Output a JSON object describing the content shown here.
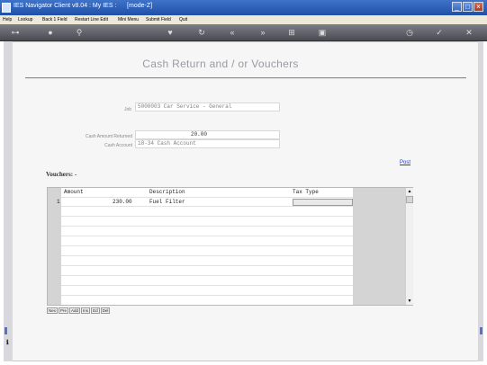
{
  "window": {
    "title": "IES Navigator Client v8.04 : My IES :      [mode-Z]"
  },
  "menu": [
    "Help",
    "Lookup",
    "Back 1 Field",
    "Restart Line Edit",
    "Mini Menu",
    "Submit Field",
    "Quit"
  ],
  "toolbar": {
    "icons": [
      "key-icon",
      "info-icon",
      "search-icon",
      "heart-icon",
      "refresh-icon",
      "rewind-icon",
      "fast-forward-icon",
      "grid-icon",
      "save-icon",
      "clock-icon",
      "check-icon",
      "close-icon"
    ]
  },
  "form": {
    "title": "Cash Return and / or Vouchers",
    "job_label": "Job",
    "job_value": "5000003 Car Service - General",
    "cash_amount_label": "Cash Amount Returned",
    "cash_amount_value": "20.00",
    "cash_account_label": "Cash Account",
    "cash_account_value": "18-34 Cash Account"
  },
  "vouchers": {
    "label": "Vouchers: -",
    "post_link": "Post",
    "columns": [
      "Amount",
      "Description",
      "Tax Type"
    ],
    "rows": [
      {
        "num": "1",
        "amount": "230.00",
        "description": "Fuel Filter",
        "tax_type": ""
      }
    ],
    "buttons": [
      "Nex",
      "Pre",
      "Add",
      "Ins",
      "Ed",
      "Del"
    ]
  }
}
